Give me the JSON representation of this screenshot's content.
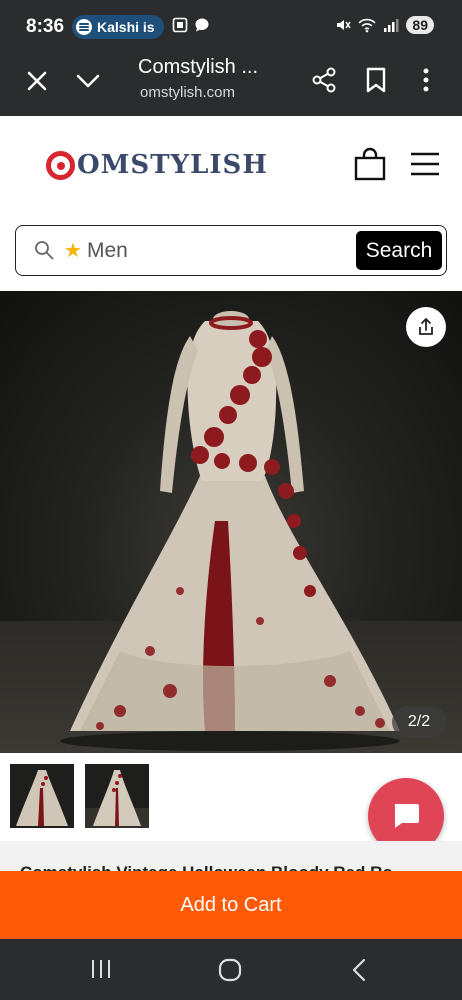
{
  "status_bar": {
    "time": "8:36",
    "notification_text": "Kalshi is",
    "battery": "89",
    "wifi_label": "5"
  },
  "browser": {
    "title": "Comstylish ...",
    "url": "omstylish.com"
  },
  "site": {
    "logo_text": "OMSTYLISH",
    "brand_color": "#d7262f",
    "logo_text_color": "#3b4a6b"
  },
  "search": {
    "value": "Men",
    "button_label": "Search"
  },
  "gallery": {
    "counter": "2/2",
    "thumbnail_count": 2
  },
  "product": {
    "title_partial": "Comstylish Vintage Halloween Bloody Red Ro..."
  },
  "actions": {
    "add_to_cart_label": "Add to Cart",
    "accent_color": "#ff5a08"
  }
}
